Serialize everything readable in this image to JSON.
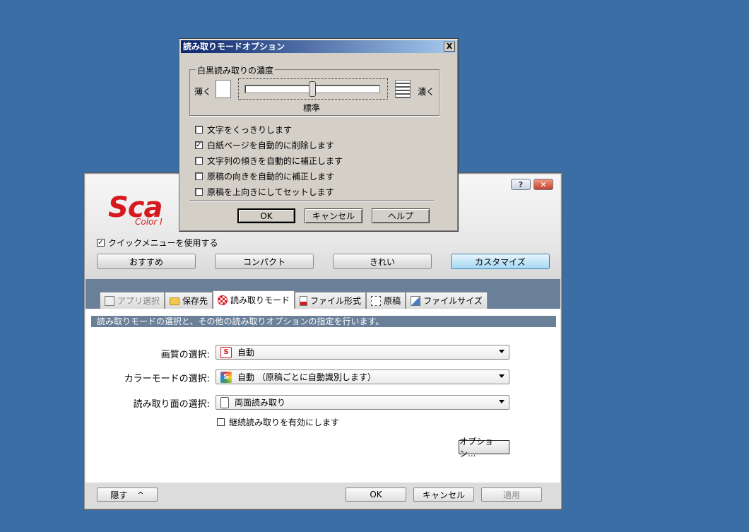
{
  "main": {
    "logo_text": "Sca",
    "logo_sub": "Color I",
    "help_label": "?",
    "close_label": "✕",
    "quick_menu_label": "クイックメニューを使用する",
    "quick_menu_checked": true,
    "presets": [
      {
        "label": "おすすめ",
        "active": false
      },
      {
        "label": "コンパクト",
        "active": false
      },
      {
        "label": "きれい",
        "active": false
      },
      {
        "label": "カスタマイズ",
        "active": true
      }
    ],
    "tabs": [
      {
        "label": "アプリ選択",
        "icon": "app-select-icon",
        "active": false,
        "disabled": true
      },
      {
        "label": "保存先",
        "icon": "folder-icon",
        "active": false,
        "disabled": false
      },
      {
        "label": "読み取りモード",
        "icon": "scan-mode-icon",
        "active": true,
        "disabled": false
      },
      {
        "label": "ファイル形式",
        "icon": "file-format-icon",
        "active": false,
        "disabled": false
      },
      {
        "label": "原稿",
        "icon": "document-icon",
        "active": false,
        "disabled": false
      },
      {
        "label": "ファイルサイズ",
        "icon": "file-size-icon",
        "active": false,
        "disabled": false
      }
    ],
    "description": "読み取りモードの選択と、その他の読み取りオプションの指定を行います。",
    "image_quality": {
      "label": "画質の選択:",
      "value": "自動"
    },
    "color_mode": {
      "label": "カラーモードの選択:",
      "value": "自動 （原稿ごとに自動識別します）"
    },
    "scan_side": {
      "label": "読み取り面の選択:",
      "value": "両面読み取り"
    },
    "continuous_scan": {
      "label": "継続読み取りを有効にします",
      "checked": false
    },
    "options_button": "オプション...",
    "hide_button": "隠す",
    "hide_chevron": "^",
    "ok_button": "OK",
    "cancel_button": "キャンセル",
    "apply_button": "適用"
  },
  "dialog": {
    "title": "読み取りモードオプション",
    "close_label": "X",
    "group_title": "白黒読み取りの濃度",
    "light_label": "薄く",
    "dark_label": "濃く",
    "standard_label": "標準",
    "slider_value_fraction": 0.5,
    "options": [
      {
        "label": "文字をくっきりします",
        "checked": false
      },
      {
        "label": "白紙ページを自動的に削除します",
        "checked": true
      },
      {
        "label": "文字列の傾きを自動的に補正します",
        "checked": false
      },
      {
        "label": "原稿の向きを自動的に補正します",
        "checked": false
      },
      {
        "label": "原稿を上向きにしてセットします",
        "checked": false
      }
    ],
    "ok_button": "OK",
    "cancel_button": "キャンセル",
    "help_button": "ヘルプ"
  },
  "colors": {
    "desktop": "#3a6ea5",
    "band": "#6a7f98",
    "logo_red": "#d7181f",
    "title_bar_start": "#0a246a",
    "title_bar_end": "#a6caf0"
  }
}
